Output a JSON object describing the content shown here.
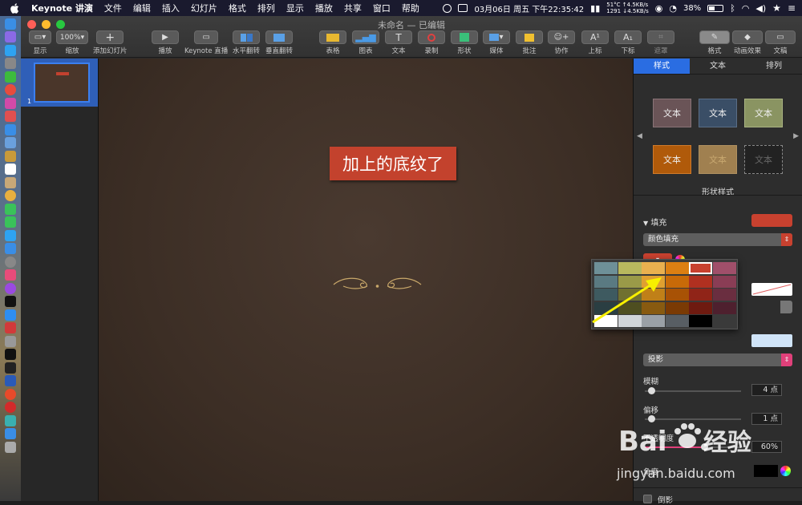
{
  "menubar": {
    "app": "Keynote 讲演",
    "items": [
      "文件",
      "编辑",
      "插入",
      "幻灯片",
      "格式",
      "排列",
      "显示",
      "播放",
      "共享",
      "窗口",
      "帮助"
    ],
    "datetime": "03月06日 周五 下午22:35:42",
    "temp": "51°C",
    "num": "1291",
    "up": "↑4.5KB/s",
    "down": "↓4.5KB/s",
    "battery": "38%"
  },
  "window": {
    "title": "未命名 — 已编辑",
    "zoom": "100%"
  },
  "toolbar": {
    "view": "显示",
    "zoom": "缩放",
    "add_slide": "添加幻灯片",
    "play": "播放",
    "keynote_live": "Keynote 直播",
    "flip_h": "水平翻转",
    "flip_v": "垂直翻转",
    "table": "表格",
    "chart": "图表",
    "text": "文本",
    "record": "录制",
    "shape": "形状",
    "media": "媒体",
    "comment": "批注",
    "collab": "协作",
    "superscript": "上标",
    "subscript": "下标",
    "mask": "遮罩",
    "format": "格式",
    "animate": "动画效果",
    "document": "文稿"
  },
  "navigator": {
    "slide_number": "1"
  },
  "slide": {
    "title_text": "加上的底纹了"
  },
  "inspector": {
    "tabs": [
      "样式",
      "文本",
      "排列"
    ],
    "style_swatch_text": "文本",
    "shape_styles_label": "形状样式",
    "fill_label": "填充",
    "fill_type": "颜色填充",
    "fill_color": "#c8412f",
    "shadow_type": "投影",
    "blur_label": "模糊",
    "blur_value": "4 点",
    "offset_label": "偏移",
    "offset_value": "1 点",
    "opacity_label": "不透明度",
    "opacity_value": "60%",
    "angle_label": "角度",
    "reflection_label": "倒影"
  },
  "color_popup": {
    "rows": [
      [
        "#6e9098",
        "#b8b85e",
        "#e9b04f",
        "#dc7f12",
        "#c8412f",
        "#a04f6a"
      ],
      [
        "#5a7a82",
        "#9a9a48",
        "#e0a030",
        "#c86a08",
        "#b03020",
        "#8a3d55"
      ],
      [
        "#3e5a60",
        "#707030",
        "#c08018",
        "#a85205",
        "#902418",
        "#6a2e40"
      ],
      [
        "#2a3e42",
        "#4e4e20",
        "#885a10",
        "#7a3a04",
        "#6e1a10",
        "#4e202e"
      ],
      [
        "#ffffff",
        "#d0d4d8",
        "#9aa0a6",
        "#585e64",
        "#000000",
        "#3a3a3a"
      ]
    ],
    "selected_color": "#c8412f"
  },
  "watermark": {
    "brand": "Bai 经验",
    "url": "jingyan.baidu.com"
  }
}
